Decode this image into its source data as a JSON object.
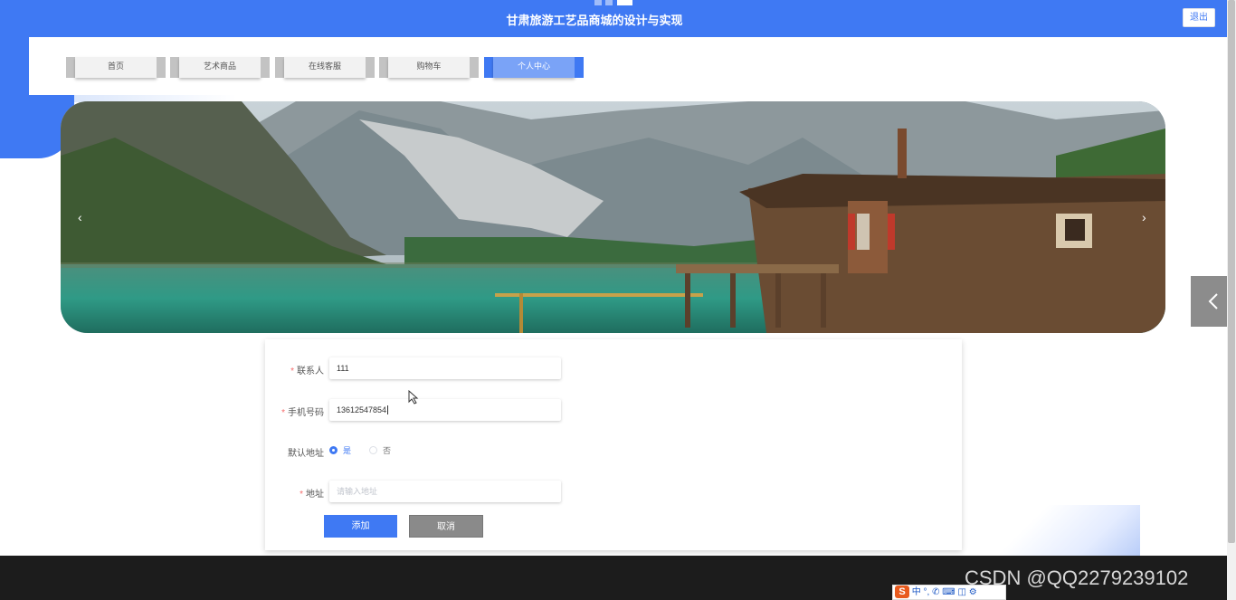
{
  "header": {
    "title": "甘肃旅游工艺品商城的设计与实现",
    "logout_label": "退出"
  },
  "nav": {
    "items": [
      {
        "label": "首页"
      },
      {
        "label": "艺术商品"
      },
      {
        "label": "在线客服"
      },
      {
        "label": "购物车"
      },
      {
        "label": "个人中心"
      }
    ],
    "active_index": 4
  },
  "carousel": {
    "prev_label": "‹",
    "next_label": "›",
    "slide_count": 3,
    "active_slide": 3
  },
  "form": {
    "contact": {
      "label": "联系人",
      "value": "111",
      "required": true
    },
    "phone": {
      "label": "手机号码",
      "value": "13612547854",
      "required": true
    },
    "default_address": {
      "label": "默认地址",
      "options": [
        "是",
        "否"
      ],
      "selected": "是"
    },
    "address": {
      "label": "地址",
      "placeholder": "请输入地址",
      "value": "",
      "required": true
    },
    "add_label": "添加",
    "cancel_label": "取消"
  },
  "overlay": {
    "watermark": "CSDN @QQ2279239102",
    "ime_text": "中 °, ✆ ⌨ ◫ ⚙"
  },
  "colors": {
    "accent": "#3f79f3",
    "footer": "#1c1c1c",
    "cancel": "#8a8a8a",
    "required": "#f56c6c"
  }
}
